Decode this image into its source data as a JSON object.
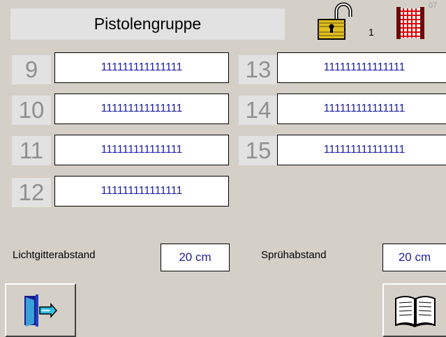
{
  "header": {
    "title": "Pistolengruppe",
    "lock_count": "1",
    "corner_text": "07",
    "lock_icon": "padlock-open-icon",
    "curtain_icon": "light-curtain-icon"
  },
  "guns": [
    {
      "number": "9",
      "value": "111111111111111"
    },
    {
      "number": "10",
      "value": "111111111111111"
    },
    {
      "number": "11",
      "value": "111111111111111"
    },
    {
      "number": "12",
      "value": "111111111111111"
    },
    {
      "number": "13",
      "value": "111111111111111"
    },
    {
      "number": "14",
      "value": "111111111111111"
    },
    {
      "number": "15",
      "value": "111111111111111"
    }
  ],
  "settings": {
    "light_grid_label": "Lichtgitterabstand",
    "light_grid_value": "20 cm",
    "spray_label": "Sprühabstand",
    "spray_value": "20 cm"
  },
  "footer": {
    "exit_icon": "exit-door-icon",
    "book_icon": "open-book-icon"
  },
  "colors": {
    "background": "#d4d0c8",
    "value_text": "#1e1ea0",
    "number_text": "#909090"
  }
}
